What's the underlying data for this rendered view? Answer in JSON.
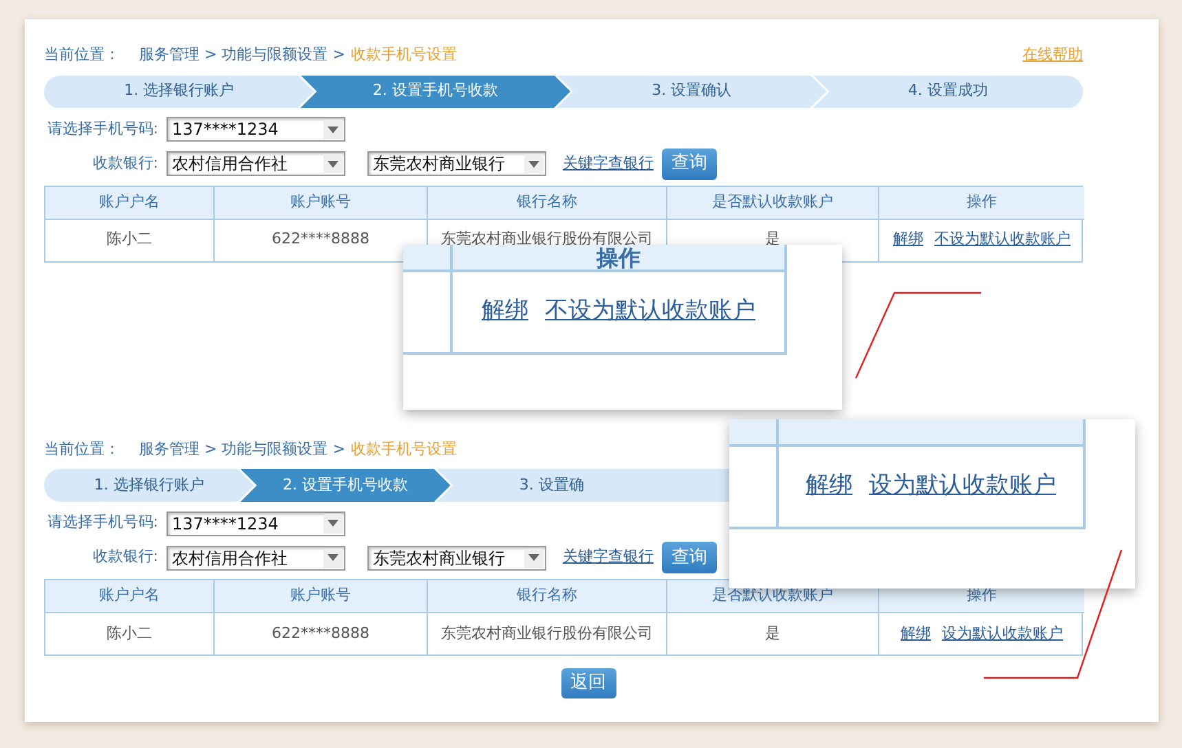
{
  "panels": [
    {
      "breadcrumb": {
        "label": "当前位置：",
        "path": "服务管理 > 功能与限额设置 >",
        "current": "收款手机号设置"
      },
      "help_link": "在线帮助",
      "steps": [
        {
          "label": "1. 选择银行账户",
          "selected": false
        },
        {
          "label": "2. 设置手机号收款",
          "selected": true
        },
        {
          "label": "3. 设置确认",
          "selected": false
        },
        {
          "label": "4. 设置成功",
          "selected": false
        }
      ],
      "phone": {
        "label": "请选择手机号码:",
        "value": "137****1234"
      },
      "bank": {
        "label": "收款银行:",
        "category": "农村信用合作社",
        "name": "东莞农村商业银行"
      },
      "keyword_link": "关键字查银行",
      "query_button": "查询",
      "table": {
        "columns": [
          "账户户名",
          "账户账号",
          "银行名称",
          "是否默认收款账户",
          "操作"
        ],
        "rows": [
          {
            "cells": [
              "陈小二",
              "622****8888",
              "东莞农村商业银行股份有限公司",
              "是"
            ],
            "actions": [
              "解绑",
              "不设为默认收款账户"
            ]
          }
        ]
      }
    },
    {
      "breadcrumb": {
        "label": "当前位置：",
        "path": "服务管理 > 功能与限额设置 >",
        "current": "收款手机号设置"
      },
      "steps": [
        {
          "label": "1. 选择银行账户",
          "selected": false
        },
        {
          "label": "2. 设置手机号收款",
          "selected": true
        },
        {
          "label": "3. 设置确",
          "selected": false
        }
      ],
      "phone": {
        "label": "请选择手机号码:",
        "value": "137****1234"
      },
      "bank": {
        "label": "收款银行:",
        "category": "农村信用合作社",
        "name": "东莞农村商业银行"
      },
      "keyword_link": "关键字查银行",
      "query_button": "查询",
      "table": {
        "columns": [
          "账户户名",
          "账户账号",
          "银行名称",
          "是否默认收款账户",
          "操作"
        ],
        "rows": [
          {
            "cells": [
              "陈小二",
              "622****8888",
              "东莞农村商业银行股份有限公司",
              "是"
            ],
            "actions": [
              "解绑",
              "设为默认收款账户"
            ]
          }
        ]
      },
      "back_button": "返回"
    }
  ],
  "callouts": [
    {
      "header": "操作",
      "actions": [
        "解绑",
        "不设为默认收款账户"
      ]
    },
    {
      "actions": [
        "解绑",
        "设为默认收款账户"
      ]
    }
  ]
}
